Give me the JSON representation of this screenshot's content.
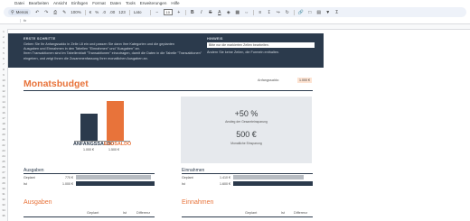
{
  "menu": [
    "Datei",
    "Bearbeiten",
    "Ansicht",
    "Einfügen",
    "Format",
    "Daten",
    "Tools",
    "Erweiterungen",
    "Hilfe"
  ],
  "toolbar": {
    "search": "Menüs",
    "zoom": "100%",
    "currency": "€",
    "percent": "%",
    "decimals_less": ".0",
    "decimals_more": ".00",
    "number_format": "123",
    "font": "Lato",
    "font_size": "10"
  },
  "panel": {
    "left_title": "ERSTE SCHRITTE",
    "left_lines": [
      "Geben Sie Ihr Anfangssaldo in Zelle L8 ein und passen Sie dann Ihre Kategorien und die geplanten",
      "Ausgaben und Einnahmen in den Tabellen \"Einnahmen\" und \"Ausgaben\" an.",
      "Ihren Transaktionen sind im Tabellenblatt \"Transaktionen\" einzutragen, damit die Daten in die Tabelle \"Transaktionen\"",
      "eingeben, und zeigt Ihnen die Zusammenfassung Ihrer monatlichen Ausgaben an."
    ],
    "right_title": "HINWEIS",
    "right_input": "Bitte nur die markierten Zellen bearbeiten.",
    "right_line": "Ändern Sie keine Zeilen, die Formeln enthalten."
  },
  "budget": {
    "title": "Monatsbudget",
    "anfangssaldo_label": "Anfangssaldo:",
    "anfangssaldo_value": "1.000 €"
  },
  "bars": {
    "anfang_label": "ANFANGSSALDO",
    "anfang_value": "1.000 €",
    "end_label": "ENDSALDO",
    "end_value": "1.500 €"
  },
  "stats": {
    "percent": "+50 %",
    "percent_label": "Anstieg der Gesamteinsparung",
    "euro": "500 €",
    "euro_label": "Monatliche Einsparung"
  },
  "ausgaben": {
    "title": "Ausgaben",
    "geplant_label": "Geplant",
    "geplant_value": "770 €",
    "ist_label": "Ist",
    "ist_value": "1.000 €"
  },
  "einnahmen": {
    "title": "Einnahmen",
    "geplant_label": "Geplant",
    "geplant_value": "1.410 €",
    "ist_label": "Ist",
    "ist_value": "1.600 €"
  },
  "tables": {
    "ausgaben_title": "Ausgaben",
    "einnahmen_title": "Einnahmen",
    "columns": [
      "Geplant",
      "Ist",
      "Differenz"
    ]
  },
  "row_numbers": [
    "1",
    "2",
    "3",
    "4",
    "5",
    "6",
    "7",
    "8",
    "9",
    "10",
    "11",
    "12",
    "13",
    "14",
    "15",
    "16",
    "17",
    "18",
    "19",
    "20",
    "21",
    "22",
    "23",
    "24",
    "25",
    "26",
    "27",
    "28",
    "29",
    "30",
    "31",
    "32",
    "33",
    "34",
    "35"
  ],
  "colors": {
    "navy": "#2b3a4c",
    "orange": "#e8733a",
    "grey_bar": "#b7bcc2",
    "stat_bg": "#e6e9ed"
  }
}
